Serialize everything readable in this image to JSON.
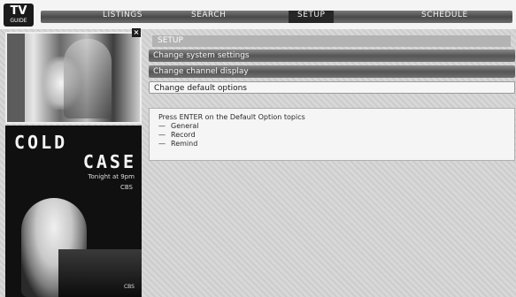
{
  "logo": {
    "big": "TV",
    "small": "GUIDE"
  },
  "menu": [
    {
      "label": "LISTINGS",
      "active": false
    },
    {
      "label": "SEARCH",
      "active": false
    },
    {
      "label": "SETUP",
      "active": true
    },
    {
      "label": "SCHEDULE",
      "active": false
    }
  ],
  "preview": {
    "close_glyph": "×"
  },
  "poster": {
    "title_line1": "COLD",
    "title_line2": "CASE",
    "tagline": "Tonight at 9pm",
    "network": "CBS",
    "footer": "CBS"
  },
  "setup": {
    "header": "SETUP",
    "options": [
      {
        "label": "Change system settings"
      },
      {
        "label": "Change channel display"
      },
      {
        "label": "Change default options",
        "selected": true
      }
    ],
    "info": {
      "prompt": "Press ENTER on the Default Option topics",
      "topics": [
        "General",
        "Record",
        "Remind"
      ],
      "bullet": "—"
    }
  },
  "colors": {
    "menu_bar": "#4a4a4a",
    "menu_active": "#262626",
    "option_bar": "#555555",
    "selected_bg": "#f6f6f6",
    "poster_bg": "#101010"
  }
}
